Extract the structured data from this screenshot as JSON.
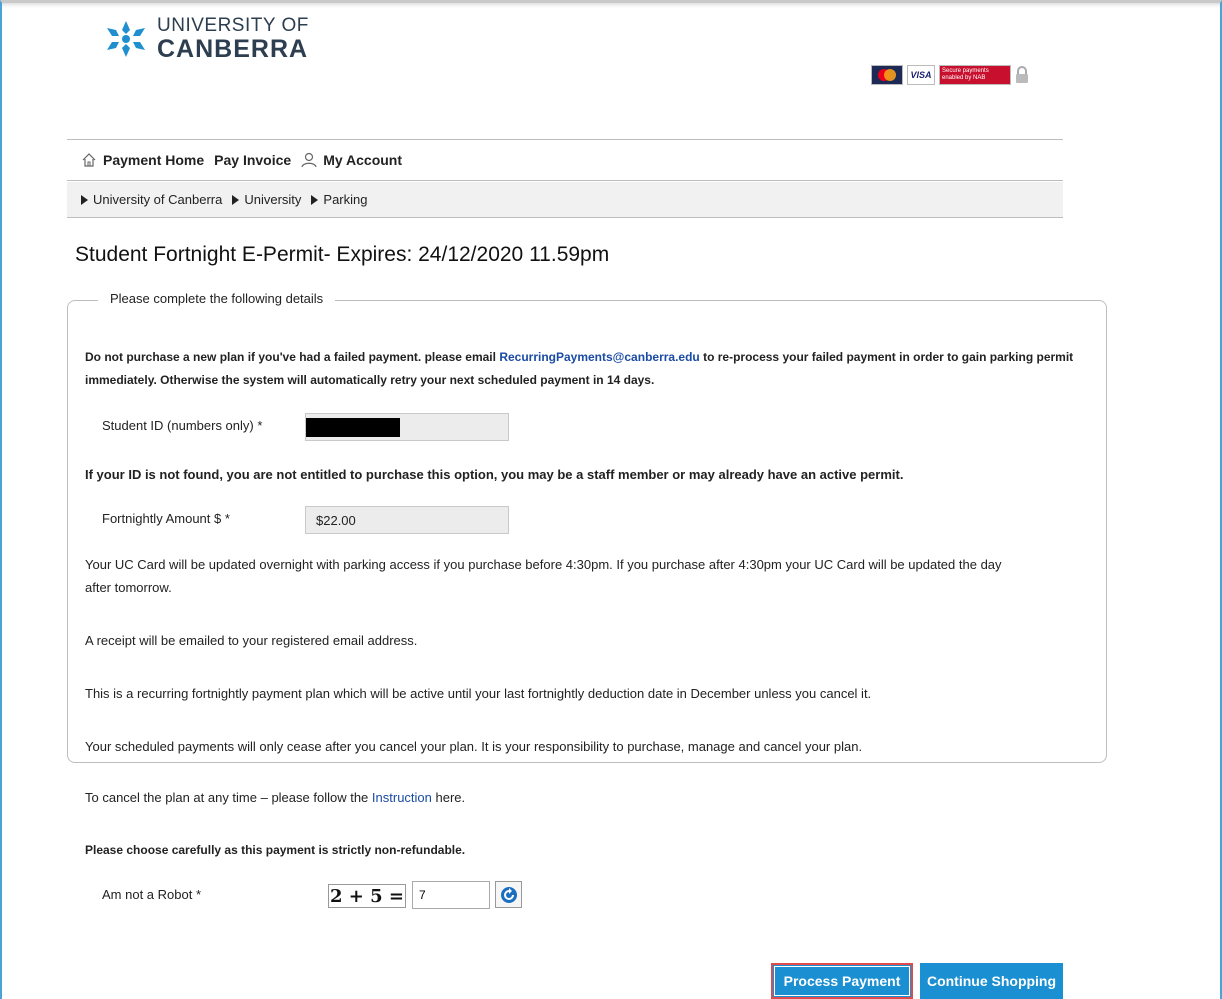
{
  "header": {
    "logo_line1": "UNIVERSITY OF",
    "logo_line2": "CANBERRA",
    "cards": {
      "visa": "VISA",
      "nab": "Secure payments enabled by NAB"
    }
  },
  "nav": {
    "items": [
      {
        "label": "Payment Home",
        "icon": "home-icon"
      },
      {
        "label": "Pay Invoice",
        "icon": ""
      },
      {
        "label": "My Account",
        "icon": "user-icon"
      }
    ]
  },
  "breadcrumb": [
    "University of Canberra",
    "University",
    "Parking"
  ],
  "page": {
    "title": "Student Fortnight E-Permit- Expires: 24/12/2020 11.59pm",
    "legend": "Please complete the following details"
  },
  "notice": {
    "part1": "Do not purchase a new plan if you've had a failed payment. please email ",
    "email": "RecurringPayments@canberra.edu",
    "part2": " to re-process your failed payment in order to gain parking permit",
    "line2": "immediately. Otherwise the system will automatically retry your next scheduled payment in 14 days."
  },
  "form": {
    "student_id_label": "Student ID (numbers only) *",
    "student_id_value": "",
    "id_warning": "If your ID is not found, you are not entitled to purchase this option, you may be a staff member or may already have an active permit.",
    "amount_label": "Fortnightly Amount $ *",
    "amount_value": "$22.00",
    "robot_label": "Am not a Robot *",
    "captcha": "2 + 5 =",
    "captcha_answer": "7"
  },
  "info": {
    "uc_card_1": "Your UC Card will be updated overnight with parking access if you purchase before 4:30pm. If you purchase after 4:30pm your UC Card will be updated the day",
    "uc_card_2": "after tomorrow.",
    "receipt": "A receipt will be emailed to your registered email address.",
    "recurring": "This is a recurring fortnightly payment plan which will be active until your last fortnightly deduction date in December unless you cancel it.",
    "responsibility": "Your scheduled payments will only cease after you cancel your plan. It is your responsibility to purchase, manage and cancel your plan.",
    "cancel_pre": "To cancel the plan at any time – please follow the ",
    "cancel_link": "Instruction",
    "cancel_post": " here.",
    "non_refundable": "Please choose carefully as this payment is strictly non-refundable."
  },
  "buttons": {
    "process_payment": "Process Payment",
    "continue_shopping": "Continue Shopping"
  },
  "colors": {
    "accent": "#1a8fd1",
    "link": "#1a4ba5",
    "highlight": "#e04b4b"
  }
}
